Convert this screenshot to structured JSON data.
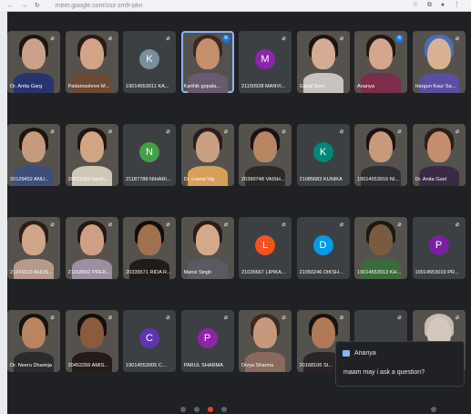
{
  "browser": {
    "nav": "← → ↻",
    "url": "meet.google.com/zsz-zmfr-pkn",
    "right": "☆ ⧉ ● ⋮"
  },
  "tiles": [
    {
      "name": "Dr. Anita Garg",
      "type": "video",
      "skin": "#caa18a",
      "hair": "#1e1512",
      "shirt": "#283470",
      "mic": "muted"
    },
    {
      "name": "Padamashree M...",
      "type": "video",
      "skin": "#d3a387",
      "hair": "#2a1a14",
      "shirt": "#6e4935",
      "mic": "muted"
    },
    {
      "name": "19014553011 KA...",
      "type": "avatar",
      "initial": "K",
      "color": "#78909c",
      "mic": "muted"
    },
    {
      "name": "Karthik gopala...",
      "type": "video",
      "skin": "#c68f6c",
      "hair": "#3a2a20",
      "shirt": "#6a5a70",
      "mic": "speaking",
      "active": true
    },
    {
      "name": "21150928 MANVI...",
      "type": "avatar",
      "initial": "M",
      "color": "#8e24aa",
      "mic": "muted"
    },
    {
      "name": "Gazal Soni",
      "type": "video",
      "skin": "#d4ab93",
      "hair": "#1c1411",
      "shirt": "#c9c3c0",
      "mic": "muted"
    },
    {
      "name": "Ananya",
      "type": "video",
      "skin": "#d4a68d",
      "hair": "#231714",
      "shirt": "#7c2d4a",
      "mic": "speaking"
    },
    {
      "name": "Hargun Kaur Sa...",
      "type": "video",
      "skin": "#d9b293",
      "hair": "#4a6fb8",
      "shirt": "#5a4fa0",
      "mic": "muted"
    },
    {
      "name": "20129452 ANU...",
      "type": "video",
      "skin": "#c59a7d",
      "hair": "#1d1410",
      "shirt": "#3d4e7a",
      "mic": "muted"
    },
    {
      "name": "20611189 Harsh...",
      "type": "video",
      "skin": "#d2a486",
      "hair": "#201510",
      "shirt": "#cfc7b8",
      "mic": "muted"
    },
    {
      "name": "21187788 NIHARI...",
      "type": "avatar",
      "initial": "N",
      "color": "#43a047",
      "mic": "muted"
    },
    {
      "name": "Dr. Leena Vig",
      "type": "video",
      "skin": "#caa083",
      "hair": "#2b1d18",
      "shirt": "#d7a05a",
      "mic": "muted"
    },
    {
      "name": "20390748 VAISH...",
      "type": "video",
      "skin": "#b88563",
      "hair": "#1a1210",
      "shirt": "#2a2a2a",
      "mic": "muted"
    },
    {
      "name": "21085683 KUNIKA",
      "type": "avatar",
      "initial": "K",
      "color": "#00897b",
      "mic": "muted"
    },
    {
      "name": "19014553016 NI...",
      "type": "video",
      "skin": "#c8997b",
      "hair": "#1b1311",
      "shirt": "#2e2e34",
      "mic": "muted"
    },
    {
      "name": "Dr. Anita Goel",
      "type": "video",
      "skin": "#c48e6e",
      "hair": "#2a1e1a",
      "shirt": "#3a2a44",
      "mic": "muted"
    },
    {
      "name": "21241610 KHUS...",
      "type": "video",
      "skin": "#d0a588",
      "hair": "#2b1e18",
      "shirt": "#b69a8a",
      "mic": "muted"
    },
    {
      "name": "21018992 PRER...",
      "type": "video",
      "skin": "#cda084",
      "hair": "#231812",
      "shirt": "#9c8f9f",
      "mic": "muted"
    },
    {
      "name": "20335571 RIDA R...",
      "type": "video",
      "skin": "#a0704f",
      "hair": "#120d0b",
      "shirt": "#1f1c1b",
      "mic": "muted"
    },
    {
      "name": "Mansi Singh",
      "type": "video",
      "skin": "#d3a98c",
      "hair": "#2b1d17",
      "shirt": "#5a5a62",
      "mic": "muted"
    },
    {
      "name": "21026667 LIPIKA...",
      "type": "avatar",
      "initial": "L",
      "color": "#f4511e",
      "mic": "muted"
    },
    {
      "name": "21050246 DIKSH...",
      "type": "avatar",
      "initial": "D",
      "color": "#039be5",
      "mic": "muted"
    },
    {
      "name": "19014553013 KH...",
      "type": "video",
      "skin": "#7a5a40",
      "hair": "#1a1a12",
      "shirt": "#3b6a3b",
      "mic": "muted"
    },
    {
      "name": "19014553019 PR...",
      "type": "avatar",
      "initial": "P",
      "color": "#7b1fa2",
      "mic": "muted"
    },
    {
      "name": "Dr. Neeru Dhamija",
      "type": "video",
      "skin": "#b88560",
      "hair": "#1a120f",
      "shirt": "#2b2b2b",
      "mic": "muted"
    },
    {
      "name": "20452266 AMIS...",
      "type": "video",
      "skin": "#8a5c3c",
      "hair": "#140e0b",
      "shirt": "#241c18",
      "mic": "muted"
    },
    {
      "name": "19014553005 C...",
      "type": "avatar",
      "initial": "C",
      "color": "#5e35b1",
      "mic": "muted"
    },
    {
      "name": "PARUL SHARMA",
      "type": "avatar",
      "initial": "P",
      "color": "#8e24aa",
      "mic": "muted"
    },
    {
      "name": "Divya Sharma",
      "type": "video",
      "skin": "#c8987a",
      "hair": "#3b2a22",
      "shirt": "#8a6a5e",
      "mic": "muted"
    },
    {
      "name": "20168106 SI...",
      "type": "video",
      "skin": "#b07a58",
      "hair": "#1a120f",
      "shirt": "#2a2426",
      "mic": "muted"
    },
    {
      "name": "",
      "type": "avatar",
      "initial": "",
      "color": "#3c4043",
      "mic": "muted"
    },
    {
      "name": "",
      "type": "video",
      "skin": "#d2c8be",
      "hair": "#c5bcb2",
      "shirt": "#d8d0c8",
      "mic": "muted"
    }
  ],
  "chat": {
    "sender": "Ananya",
    "message": "maam may i ask a question?"
  },
  "icons": {
    "mic_muted": "mic-off-icon",
    "speaking": "sound-wave-icon",
    "chat": "chat-bubble-icon"
  }
}
